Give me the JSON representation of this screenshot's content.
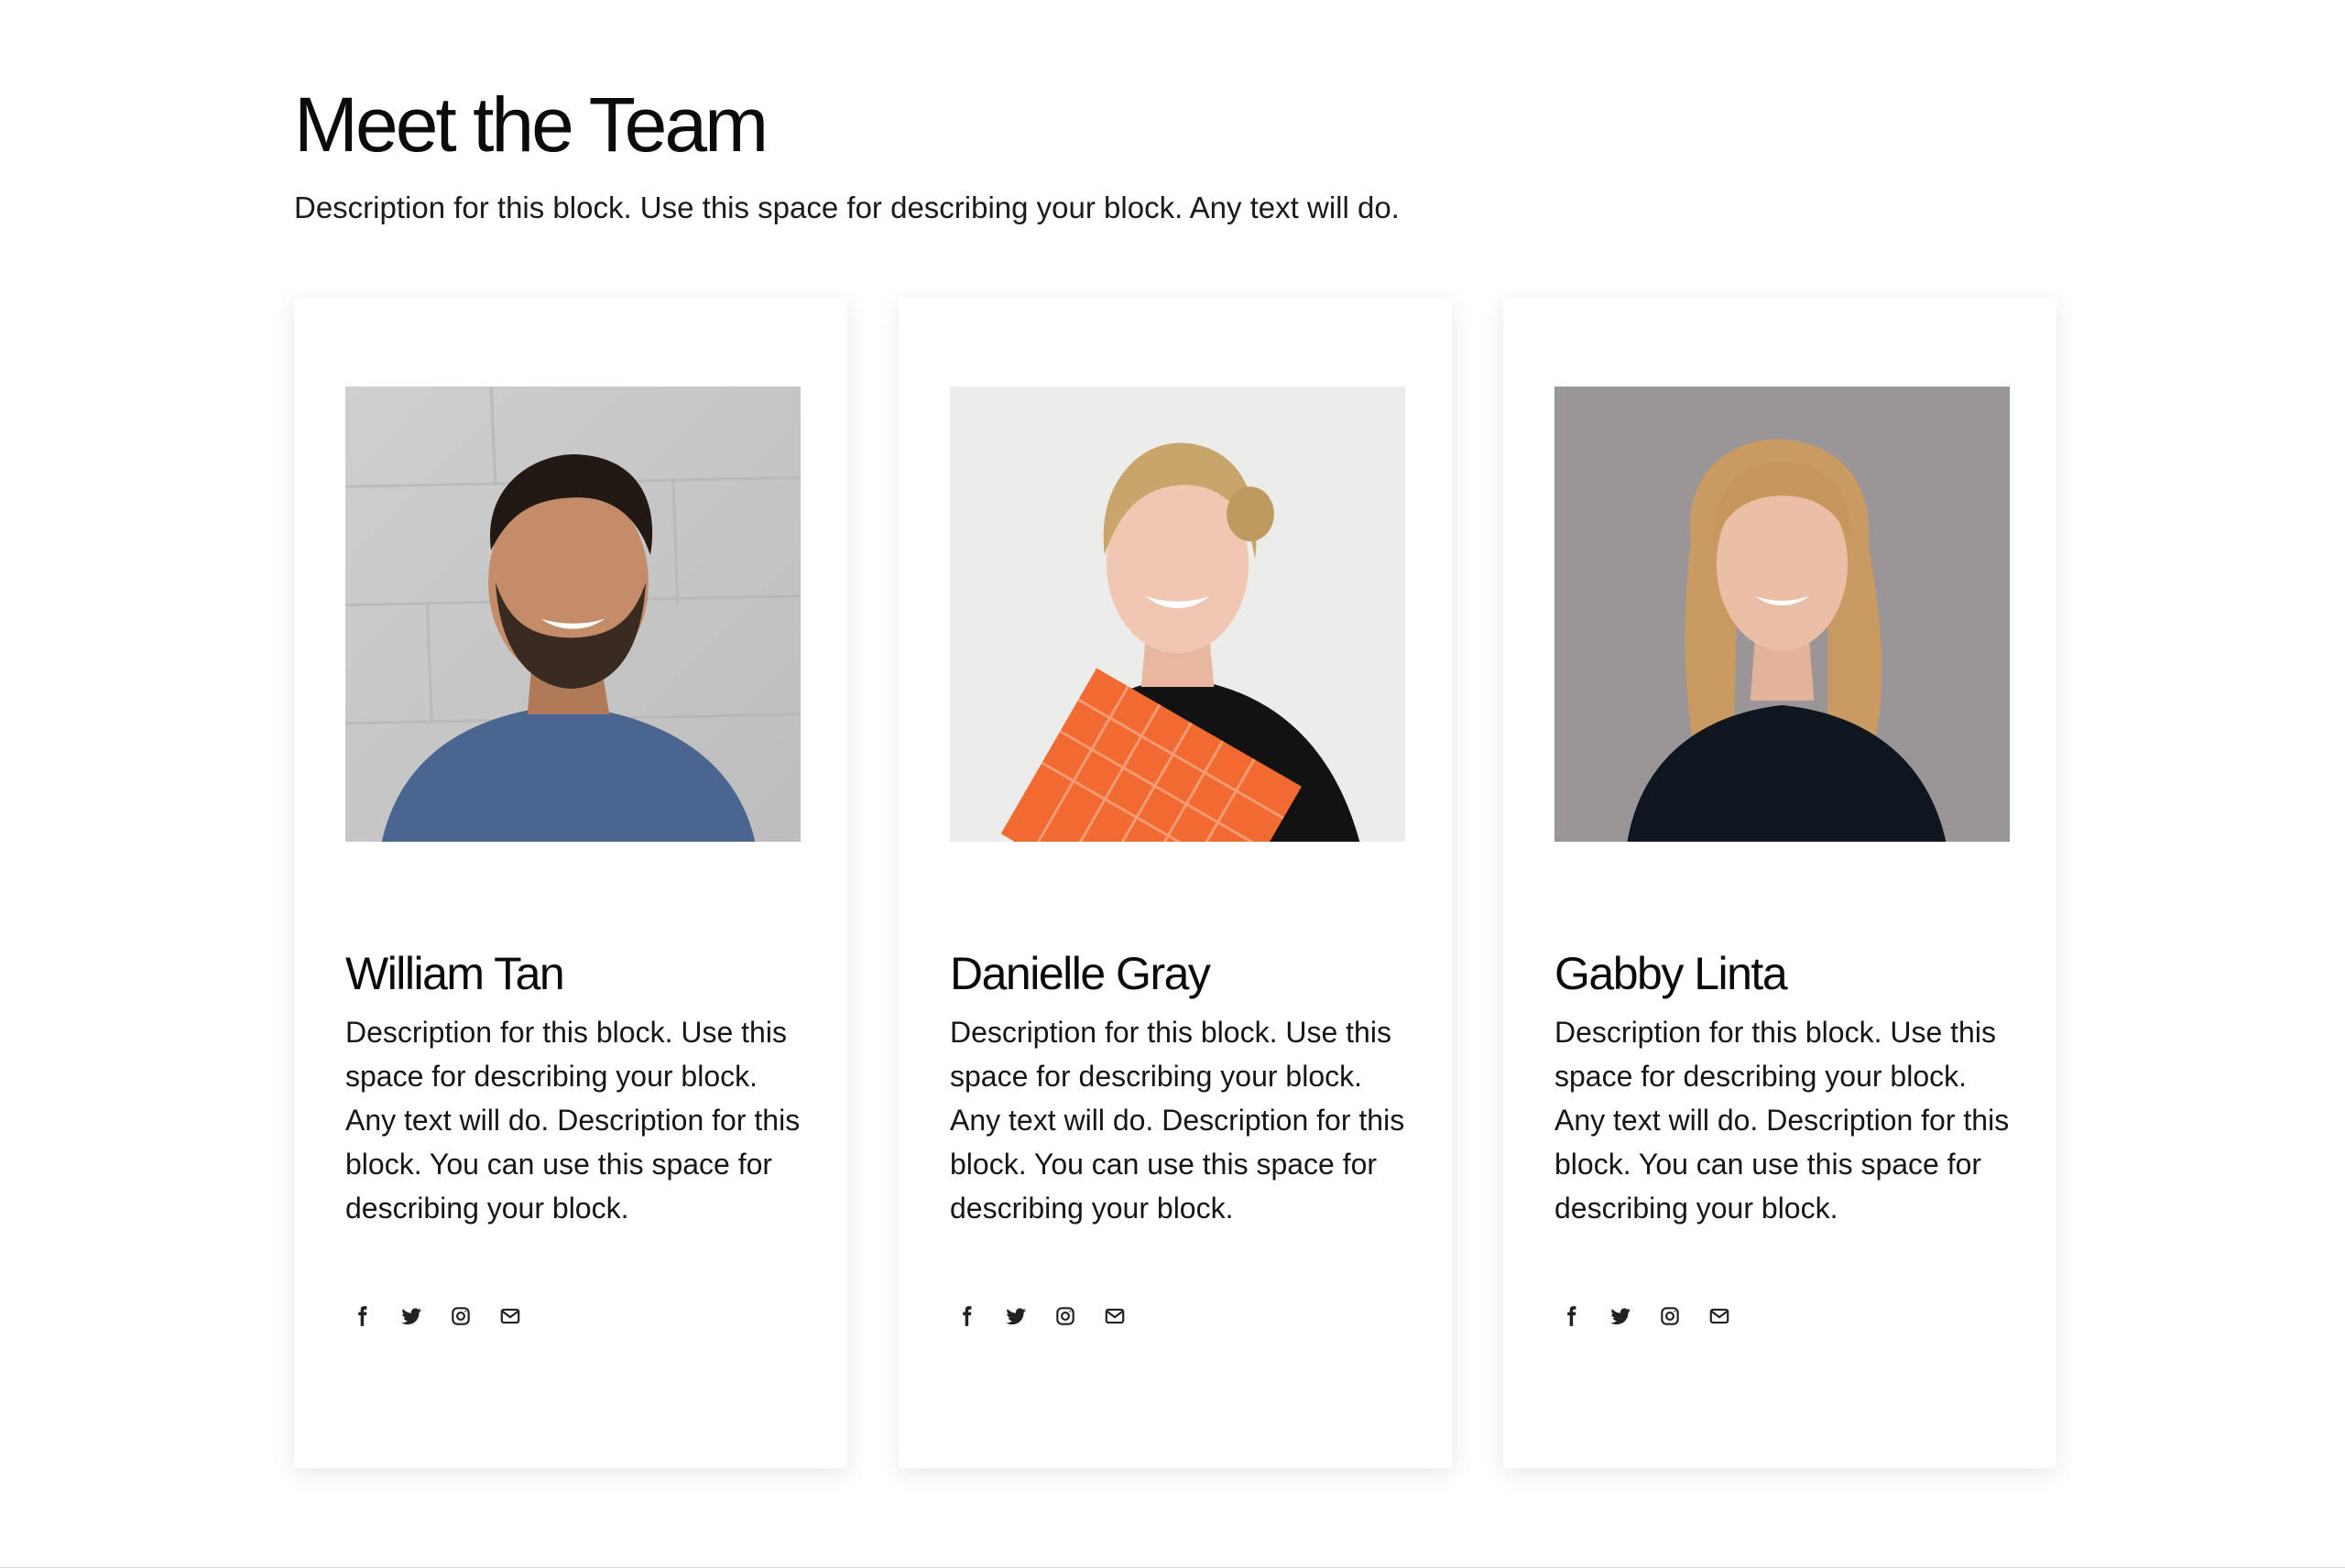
{
  "header": {
    "title": "Meet the Team",
    "description": "Description for this block. Use this space for describing your block. Any text will do."
  },
  "team": [
    {
      "name": "William Tan",
      "bio": "Description for this block. Use this space for describing your block. Any text will do. Description for this block. You can use this space for describing your block.",
      "photo_icon": "portrait-man-blue-shirt"
    },
    {
      "name": "Danielle Gray",
      "bio": "Description for this block. Use this space for describing your block. Any text will do. Description for this block. You can use this space for describing your block.",
      "photo_icon": "portrait-woman-orange-folder"
    },
    {
      "name": "Gabby Linta",
      "bio": "Description for this block. Use this space for describing your block. Any text will do. Description for this block. You can use this space for describing your block.",
      "photo_icon": "portrait-woman-grey-background"
    }
  ],
  "social_icons": [
    "facebook-icon",
    "twitter-icon",
    "instagram-icon",
    "email-icon"
  ],
  "colors": {
    "background": "#ffffff",
    "text": "#111111",
    "icon": "#222222"
  }
}
